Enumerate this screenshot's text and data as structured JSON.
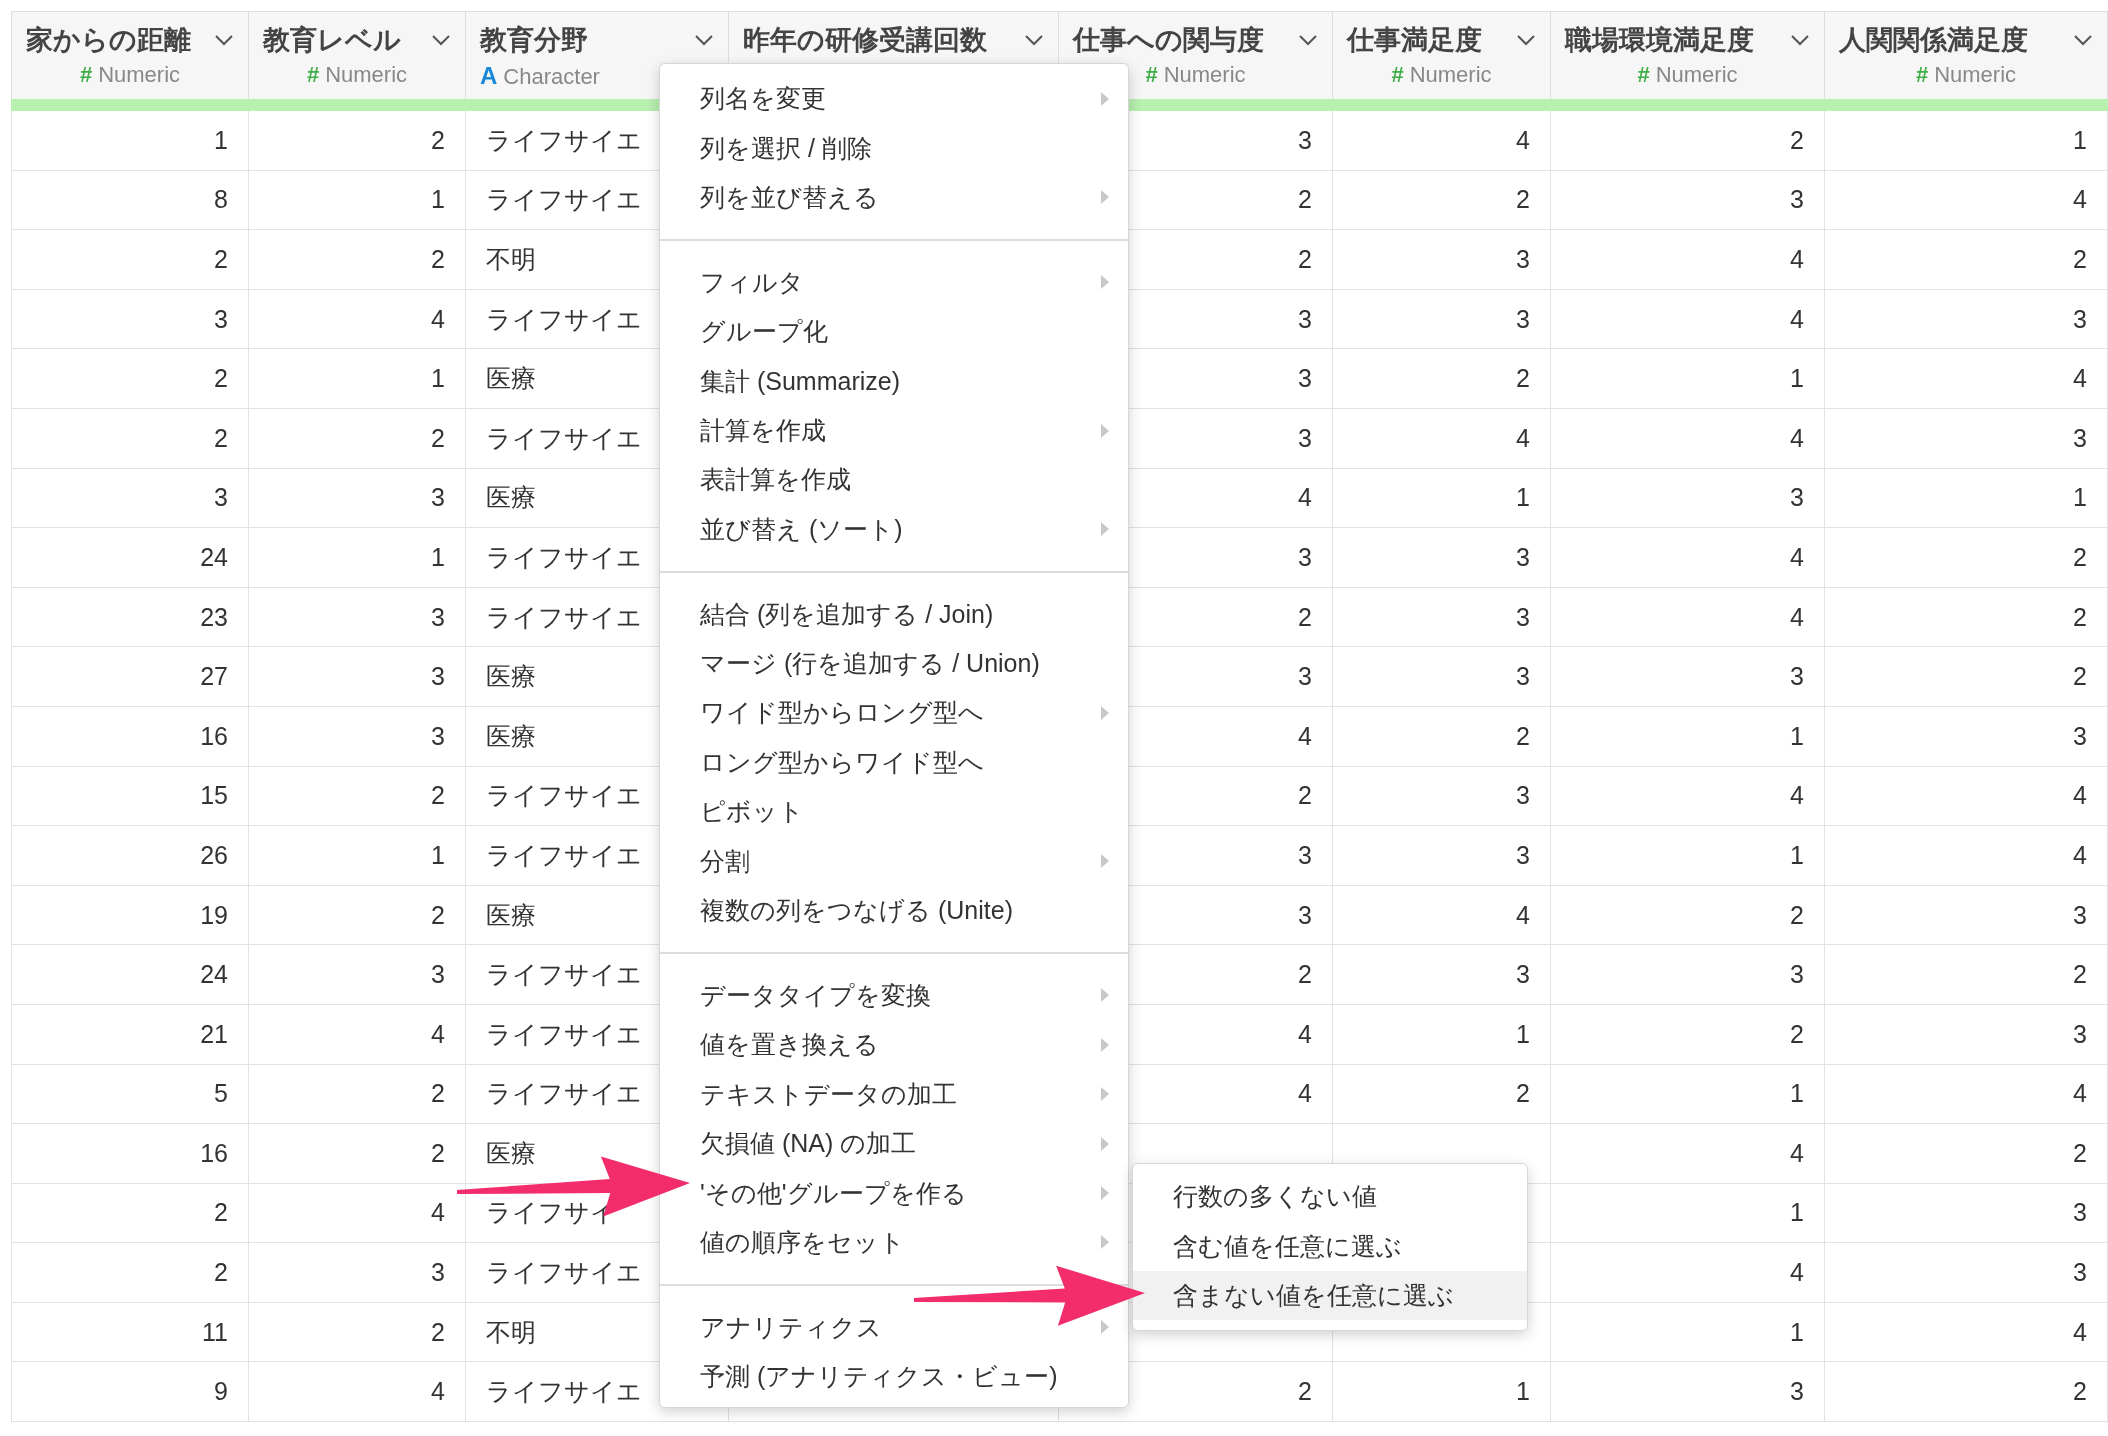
{
  "table": {
    "columns": [
      {
        "title": "家からの距離",
        "kind": "numeric",
        "type_icon": "#",
        "type_label": "Numeric"
      },
      {
        "title": "教育レベル",
        "kind": "numeric",
        "type_icon": "#",
        "type_label": "Numeric"
      },
      {
        "title": "教育分野",
        "kind": "character",
        "type_icon": "A",
        "type_label": "Character"
      },
      {
        "title": "昨年の研修受講回数",
        "kind": "numeric"
      },
      {
        "title": "仕事への関与度",
        "kind": "numeric",
        "type_icon": "#",
        "type_label": "Numeric"
      },
      {
        "title": "仕事満足度",
        "kind": "numeric",
        "type_icon": "#",
        "type_label": "Numeric"
      },
      {
        "title": "職場環境満足度",
        "kind": "numeric",
        "type_icon": "#",
        "type_label": "Numeric"
      },
      {
        "title": "人関関係満足度",
        "kind": "numeric",
        "type_icon": "#",
        "type_label": "Numeric"
      }
    ],
    "rows": [
      [
        "1",
        "2",
        "ライフサイエ",
        null,
        "3",
        "4",
        "2",
        "1"
      ],
      [
        "8",
        "1",
        "ライフサイエ",
        null,
        "2",
        "2",
        "3",
        "4"
      ],
      [
        "2",
        "2",
        "不明",
        null,
        "2",
        "3",
        "4",
        "2"
      ],
      [
        "3",
        "4",
        "ライフサイエ",
        null,
        "3",
        "3",
        "4",
        "3"
      ],
      [
        "2",
        "1",
        "医療",
        null,
        "3",
        "2",
        "1",
        "4"
      ],
      [
        "2",
        "2",
        "ライフサイエ",
        null,
        "3",
        "4",
        "4",
        "3"
      ],
      [
        "3",
        "3",
        "医療",
        null,
        "4",
        "1",
        "3",
        "1"
      ],
      [
        "24",
        "1",
        "ライフサイエ",
        null,
        "3",
        "3",
        "4",
        "2"
      ],
      [
        "23",
        "3",
        "ライフサイエ",
        null,
        "2",
        "3",
        "4",
        "2"
      ],
      [
        "27",
        "3",
        "医療",
        null,
        "3",
        "3",
        "3",
        "2"
      ],
      [
        "16",
        "3",
        "医療",
        null,
        "4",
        "2",
        "1",
        "3"
      ],
      [
        "15",
        "2",
        "ライフサイエ",
        null,
        "2",
        "3",
        "4",
        "4"
      ],
      [
        "26",
        "1",
        "ライフサイエ",
        null,
        "3",
        "3",
        "1",
        "4"
      ],
      [
        "19",
        "2",
        "医療",
        null,
        "3",
        "4",
        "2",
        "3"
      ],
      [
        "24",
        "3",
        "ライフサイエ",
        null,
        "2",
        "3",
        "3",
        "2"
      ],
      [
        "21",
        "4",
        "ライフサイエ",
        null,
        "4",
        "1",
        "2",
        "3"
      ],
      [
        "5",
        "2",
        "ライフサイエ",
        null,
        "4",
        "2",
        "1",
        "4"
      ],
      [
        "16",
        "2",
        "医療",
        null,
        null,
        null,
        "4",
        "2"
      ],
      [
        "2",
        "4",
        "ライフサイ",
        null,
        null,
        null,
        "1",
        "3"
      ],
      [
        "2",
        "3",
        "ライフサイエ",
        null,
        null,
        null,
        "4",
        "3"
      ],
      [
        "11",
        "2",
        "不明",
        null,
        null,
        null,
        "1",
        "4"
      ],
      [
        "9",
        "4",
        "ライフサイエ",
        null,
        "2",
        "1",
        "3",
        "2"
      ]
    ]
  },
  "context_menu": {
    "groups": [
      [
        {
          "label": "列名を変更",
          "has_submenu": true
        },
        {
          "label": "列を選択 / 削除",
          "has_submenu": false
        },
        {
          "label": "列を並び替える",
          "has_submenu": true
        }
      ],
      [
        {
          "label": "フィルタ",
          "has_submenu": true
        },
        {
          "label": "グループ化",
          "has_submenu": false
        },
        {
          "label": "集計 (Summarize)",
          "has_submenu": false
        },
        {
          "label": "計算を作成",
          "has_submenu": true
        },
        {
          "label": "表計算を作成",
          "has_submenu": false
        },
        {
          "label": "並び替え (ソート)",
          "has_submenu": true
        }
      ],
      [
        {
          "label": "結合 (列を追加する / Join)",
          "has_submenu": false
        },
        {
          "label": "マージ (行を追加する / Union)",
          "has_submenu": false
        },
        {
          "label": "ワイド型からロング型へ",
          "has_submenu": true
        },
        {
          "label": "ロング型からワイド型へ",
          "has_submenu": false
        },
        {
          "label": "ピボット",
          "has_submenu": false
        },
        {
          "label": "分割",
          "has_submenu": true
        },
        {
          "label": "複数の列をつなげる (Unite)",
          "has_submenu": false
        }
      ],
      [
        {
          "label": "データタイプを変換",
          "has_submenu": true
        },
        {
          "label": "値を置き換える",
          "has_submenu": true
        },
        {
          "label": "テキストデータの加工",
          "has_submenu": true
        },
        {
          "label": "欠損値 (NA) の加工",
          "has_submenu": true
        },
        {
          "label": "'その他'グループを作る",
          "has_submenu": true
        },
        {
          "label": "値の順序をセット",
          "has_submenu": true
        }
      ],
      [
        {
          "label": "アナリティクス",
          "has_submenu": true
        },
        {
          "label": "予測 (アナリティクス・ビュー)",
          "has_submenu": false
        }
      ]
    ]
  },
  "submenu": {
    "items": [
      {
        "label": "行数の多くない値",
        "selected": false
      },
      {
        "label": "含む値を任意に選ぶ",
        "selected": false
      },
      {
        "label": "含まない値を任意に選ぶ",
        "selected": true
      }
    ]
  }
}
